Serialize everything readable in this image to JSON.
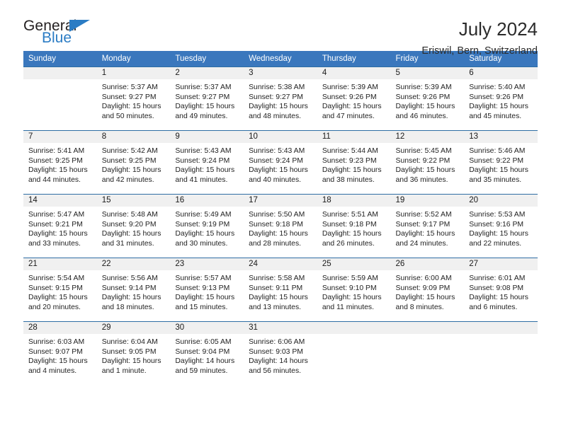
{
  "brand": {
    "name_part1": "General",
    "name_part2": "Blue",
    "triangle_color": "#2b7cc4"
  },
  "header": {
    "title": "July 2024",
    "location": "Eriswil, Bern, Switzerland",
    "header_bg": "#3a77bd",
    "row_rule_color": "#2e6da4",
    "daynum_bg": "#f0f0f0"
  },
  "weekdays": [
    "Sunday",
    "Monday",
    "Tuesday",
    "Wednesday",
    "Thursday",
    "Friday",
    "Saturday"
  ],
  "labels": {
    "sunrise": "Sunrise:",
    "sunset": "Sunset:",
    "daylight": "Daylight:"
  },
  "weeks": [
    [
      {
        "day": "",
        "sunrise": "",
        "sunset": "",
        "daylight_a": "",
        "daylight_b": ""
      },
      {
        "day": "1",
        "sunrise": "Sunrise: 5:37 AM",
        "sunset": "Sunset: 9:27 PM",
        "daylight_a": "Daylight: 15 hours",
        "daylight_b": "and 50 minutes."
      },
      {
        "day": "2",
        "sunrise": "Sunrise: 5:37 AM",
        "sunset": "Sunset: 9:27 PM",
        "daylight_a": "Daylight: 15 hours",
        "daylight_b": "and 49 minutes."
      },
      {
        "day": "3",
        "sunrise": "Sunrise: 5:38 AM",
        "sunset": "Sunset: 9:27 PM",
        "daylight_a": "Daylight: 15 hours",
        "daylight_b": "and 48 minutes."
      },
      {
        "day": "4",
        "sunrise": "Sunrise: 5:39 AM",
        "sunset": "Sunset: 9:26 PM",
        "daylight_a": "Daylight: 15 hours",
        "daylight_b": "and 47 minutes."
      },
      {
        "day": "5",
        "sunrise": "Sunrise: 5:39 AM",
        "sunset": "Sunset: 9:26 PM",
        "daylight_a": "Daylight: 15 hours",
        "daylight_b": "and 46 minutes."
      },
      {
        "day": "6",
        "sunrise": "Sunrise: 5:40 AM",
        "sunset": "Sunset: 9:26 PM",
        "daylight_a": "Daylight: 15 hours",
        "daylight_b": "and 45 minutes."
      }
    ],
    [
      {
        "day": "7",
        "sunrise": "Sunrise: 5:41 AM",
        "sunset": "Sunset: 9:25 PM",
        "daylight_a": "Daylight: 15 hours",
        "daylight_b": "and 44 minutes."
      },
      {
        "day": "8",
        "sunrise": "Sunrise: 5:42 AM",
        "sunset": "Sunset: 9:25 PM",
        "daylight_a": "Daylight: 15 hours",
        "daylight_b": "and 42 minutes."
      },
      {
        "day": "9",
        "sunrise": "Sunrise: 5:43 AM",
        "sunset": "Sunset: 9:24 PM",
        "daylight_a": "Daylight: 15 hours",
        "daylight_b": "and 41 minutes."
      },
      {
        "day": "10",
        "sunrise": "Sunrise: 5:43 AM",
        "sunset": "Sunset: 9:24 PM",
        "daylight_a": "Daylight: 15 hours",
        "daylight_b": "and 40 minutes."
      },
      {
        "day": "11",
        "sunrise": "Sunrise: 5:44 AM",
        "sunset": "Sunset: 9:23 PM",
        "daylight_a": "Daylight: 15 hours",
        "daylight_b": "and 38 minutes."
      },
      {
        "day": "12",
        "sunrise": "Sunrise: 5:45 AM",
        "sunset": "Sunset: 9:22 PM",
        "daylight_a": "Daylight: 15 hours",
        "daylight_b": "and 36 minutes."
      },
      {
        "day": "13",
        "sunrise": "Sunrise: 5:46 AM",
        "sunset": "Sunset: 9:22 PM",
        "daylight_a": "Daylight: 15 hours",
        "daylight_b": "and 35 minutes."
      }
    ],
    [
      {
        "day": "14",
        "sunrise": "Sunrise: 5:47 AM",
        "sunset": "Sunset: 9:21 PM",
        "daylight_a": "Daylight: 15 hours",
        "daylight_b": "and 33 minutes."
      },
      {
        "day": "15",
        "sunrise": "Sunrise: 5:48 AM",
        "sunset": "Sunset: 9:20 PM",
        "daylight_a": "Daylight: 15 hours",
        "daylight_b": "and 31 minutes."
      },
      {
        "day": "16",
        "sunrise": "Sunrise: 5:49 AM",
        "sunset": "Sunset: 9:19 PM",
        "daylight_a": "Daylight: 15 hours",
        "daylight_b": "and 30 minutes."
      },
      {
        "day": "17",
        "sunrise": "Sunrise: 5:50 AM",
        "sunset": "Sunset: 9:18 PM",
        "daylight_a": "Daylight: 15 hours",
        "daylight_b": "and 28 minutes."
      },
      {
        "day": "18",
        "sunrise": "Sunrise: 5:51 AM",
        "sunset": "Sunset: 9:18 PM",
        "daylight_a": "Daylight: 15 hours",
        "daylight_b": "and 26 minutes."
      },
      {
        "day": "19",
        "sunrise": "Sunrise: 5:52 AM",
        "sunset": "Sunset: 9:17 PM",
        "daylight_a": "Daylight: 15 hours",
        "daylight_b": "and 24 minutes."
      },
      {
        "day": "20",
        "sunrise": "Sunrise: 5:53 AM",
        "sunset": "Sunset: 9:16 PM",
        "daylight_a": "Daylight: 15 hours",
        "daylight_b": "and 22 minutes."
      }
    ],
    [
      {
        "day": "21",
        "sunrise": "Sunrise: 5:54 AM",
        "sunset": "Sunset: 9:15 PM",
        "daylight_a": "Daylight: 15 hours",
        "daylight_b": "and 20 minutes."
      },
      {
        "day": "22",
        "sunrise": "Sunrise: 5:56 AM",
        "sunset": "Sunset: 9:14 PM",
        "daylight_a": "Daylight: 15 hours",
        "daylight_b": "and 18 minutes."
      },
      {
        "day": "23",
        "sunrise": "Sunrise: 5:57 AM",
        "sunset": "Sunset: 9:13 PM",
        "daylight_a": "Daylight: 15 hours",
        "daylight_b": "and 15 minutes."
      },
      {
        "day": "24",
        "sunrise": "Sunrise: 5:58 AM",
        "sunset": "Sunset: 9:11 PM",
        "daylight_a": "Daylight: 15 hours",
        "daylight_b": "and 13 minutes."
      },
      {
        "day": "25",
        "sunrise": "Sunrise: 5:59 AM",
        "sunset": "Sunset: 9:10 PM",
        "daylight_a": "Daylight: 15 hours",
        "daylight_b": "and 11 minutes."
      },
      {
        "day": "26",
        "sunrise": "Sunrise: 6:00 AM",
        "sunset": "Sunset: 9:09 PM",
        "daylight_a": "Daylight: 15 hours",
        "daylight_b": "and 8 minutes."
      },
      {
        "day": "27",
        "sunrise": "Sunrise: 6:01 AM",
        "sunset": "Sunset: 9:08 PM",
        "daylight_a": "Daylight: 15 hours",
        "daylight_b": "and 6 minutes."
      }
    ],
    [
      {
        "day": "28",
        "sunrise": "Sunrise: 6:03 AM",
        "sunset": "Sunset: 9:07 PM",
        "daylight_a": "Daylight: 15 hours",
        "daylight_b": "and 4 minutes."
      },
      {
        "day": "29",
        "sunrise": "Sunrise: 6:04 AM",
        "sunset": "Sunset: 9:05 PM",
        "daylight_a": "Daylight: 15 hours",
        "daylight_b": "and 1 minute."
      },
      {
        "day": "30",
        "sunrise": "Sunrise: 6:05 AM",
        "sunset": "Sunset: 9:04 PM",
        "daylight_a": "Daylight: 14 hours",
        "daylight_b": "and 59 minutes."
      },
      {
        "day": "31",
        "sunrise": "Sunrise: 6:06 AM",
        "sunset": "Sunset: 9:03 PM",
        "daylight_a": "Daylight: 14 hours",
        "daylight_b": "and 56 minutes."
      },
      {
        "day": "",
        "sunrise": "",
        "sunset": "",
        "daylight_a": "",
        "daylight_b": ""
      },
      {
        "day": "",
        "sunrise": "",
        "sunset": "",
        "daylight_a": "",
        "daylight_b": ""
      },
      {
        "day": "",
        "sunrise": "",
        "sunset": "",
        "daylight_a": "",
        "daylight_b": ""
      }
    ]
  ]
}
